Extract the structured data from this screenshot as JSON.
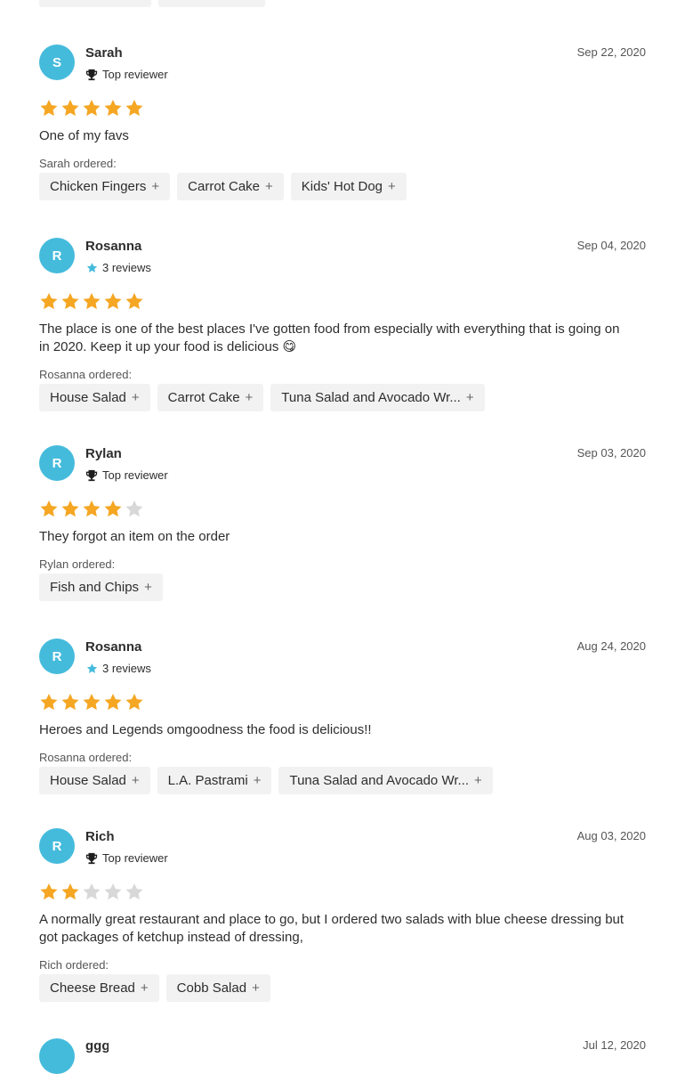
{
  "reviews": [
    {
      "initial": "S",
      "name": "Sarah",
      "badge_type": "top",
      "badge_text": "Top reviewer",
      "date": "Sep 22, 2020",
      "rating": 5,
      "text": "One of my favs",
      "ordered_label": "Sarah ordered:",
      "items": [
        "Chicken Fingers",
        "Carrot Cake",
        "Kids' Hot Dog"
      ]
    },
    {
      "initial": "R",
      "name": "Rosanna",
      "badge_type": "count",
      "badge_text": "3 reviews",
      "date": "Sep 04, 2020",
      "rating": 5,
      "text": "The place is one of the best places I've gotten food from especially with everything that is going on in 2020. Keep it up your food is delicious 😋",
      "ordered_label": "Rosanna ordered:",
      "items": [
        "House Salad",
        "Carrot Cake",
        "Tuna Salad and Avocado Wr..."
      ]
    },
    {
      "initial": "R",
      "name": "Rylan",
      "badge_type": "top",
      "badge_text": "Top reviewer",
      "date": "Sep 03, 2020",
      "rating": 4,
      "text": "They forgot an item on the order",
      "ordered_label": "Rylan ordered:",
      "items": [
        "Fish and Chips"
      ]
    },
    {
      "initial": "R",
      "name": "Rosanna",
      "badge_type": "count",
      "badge_text": "3 reviews",
      "date": "Aug 24, 2020",
      "rating": 5,
      "text": "Heroes and Legends omgoodness the food is delicious!!",
      "ordered_label": "Rosanna ordered:",
      "items": [
        "House Salad",
        "L.A. Pastrami",
        "Tuna Salad and Avocado Wr..."
      ]
    },
    {
      "initial": "R",
      "name": "Rich",
      "badge_type": "top",
      "badge_text": "Top reviewer",
      "date": "Aug 03, 2020",
      "rating": 2,
      "text": "A normally great restaurant and place to go, but I ordered two salads with blue cheese dressing but got packages of ketchup instead of dressing,",
      "ordered_label": "Rich ordered:",
      "items": [
        "Cheese Bread",
        "Cobb Salad"
      ]
    }
  ],
  "partial": {
    "name": "ggg",
    "date": "Jul 12, 2020"
  },
  "colors": {
    "avatar": "#45bbdc",
    "star_filled": "#f5a623",
    "star_empty": "#d8d8d8",
    "chip_bg": "#f2f2f2",
    "badge_star": "#45bbdc"
  },
  "icons": {
    "add": "plus-icon",
    "top_badge": "trophy-icon",
    "count_badge": "star-icon",
    "rating": "star-icon"
  }
}
